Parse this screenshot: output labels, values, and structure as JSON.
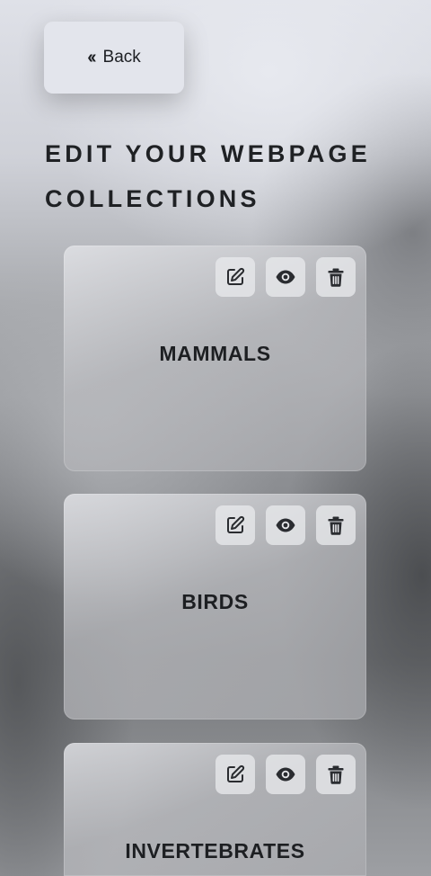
{
  "back_button": {
    "label": "Back",
    "icon": "double-chevron-left-icon"
  },
  "page": {
    "title_line1": "EDIT YOUR WEBPAGE",
    "title_line2": "COLLECTIONS"
  },
  "collections": [
    {
      "label": "MAMMALS"
    },
    {
      "label": "BIRDS"
    },
    {
      "label": "INVERTEBRATES"
    }
  ],
  "card_actions": {
    "edit_icon": "edit-icon",
    "view_icon": "eye-icon",
    "delete_icon": "trash-icon"
  },
  "colors": {
    "text": "#1d1f22",
    "button_bg": "#e3e5ec",
    "icon": "#2a2c30"
  }
}
